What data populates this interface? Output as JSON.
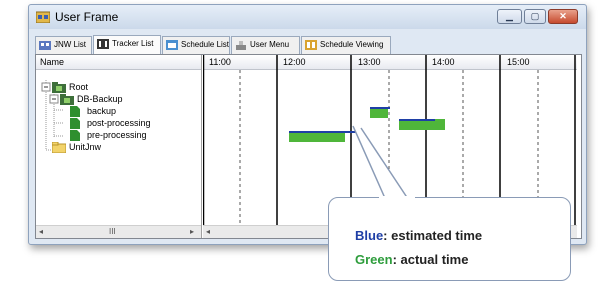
{
  "window": {
    "title": "User Frame"
  },
  "tabs": [
    {
      "label": "JNW List",
      "icon": "jnw-icon"
    },
    {
      "label": "Tracker List",
      "icon": "tracker-icon"
    },
    {
      "label": "Schedule List",
      "icon": "schedule-icon"
    },
    {
      "label": "User Menu",
      "icon": "user-menu-icon"
    },
    {
      "label": "Schedule Viewing",
      "icon": "schedule-viewing-icon"
    }
  ],
  "tree": {
    "header": "Name",
    "nodes": [
      {
        "label": "Root",
        "level": 0,
        "icon": "folder-network-icon"
      },
      {
        "label": "DB-Backup",
        "level": 1,
        "icon": "folder-network-icon"
      },
      {
        "label": "backup",
        "level": 2,
        "icon": "job-icon"
      },
      {
        "label": "post-processing",
        "level": 2,
        "icon": "job-icon"
      },
      {
        "label": "pre-processing",
        "level": 2,
        "icon": "job-icon"
      },
      {
        "label": "UnitJnw",
        "level": 0,
        "icon": "folder-icon"
      }
    ],
    "scroll_mid": "III"
  },
  "gantt": {
    "times": [
      "11:00",
      "12:00",
      "13:00",
      "14:00",
      "15:00"
    ],
    "bars": [
      {
        "job": "backup",
        "estimated_start": "13:15",
        "estimated_end": "13:30",
        "actual_start": "13:15",
        "actual_end": "13:30"
      },
      {
        "job": "post-processing",
        "estimated_start": "13:40",
        "estimated_end": "14:10",
        "actual_start": "13:40",
        "actual_end": "14:30"
      },
      {
        "job": "pre-processing",
        "estimated_start": "12:10",
        "estimated_end": "13:10",
        "actual_start": "12:10",
        "actual_end": "12:55"
      }
    ]
  },
  "legend": {
    "blue_word": "Blue",
    "blue_rest": ": estimated time",
    "green_word": "Green",
    "green_rest": ": actual time",
    "blue_color": "#1f3fa6",
    "green_color": "#2e9d3c"
  }
}
